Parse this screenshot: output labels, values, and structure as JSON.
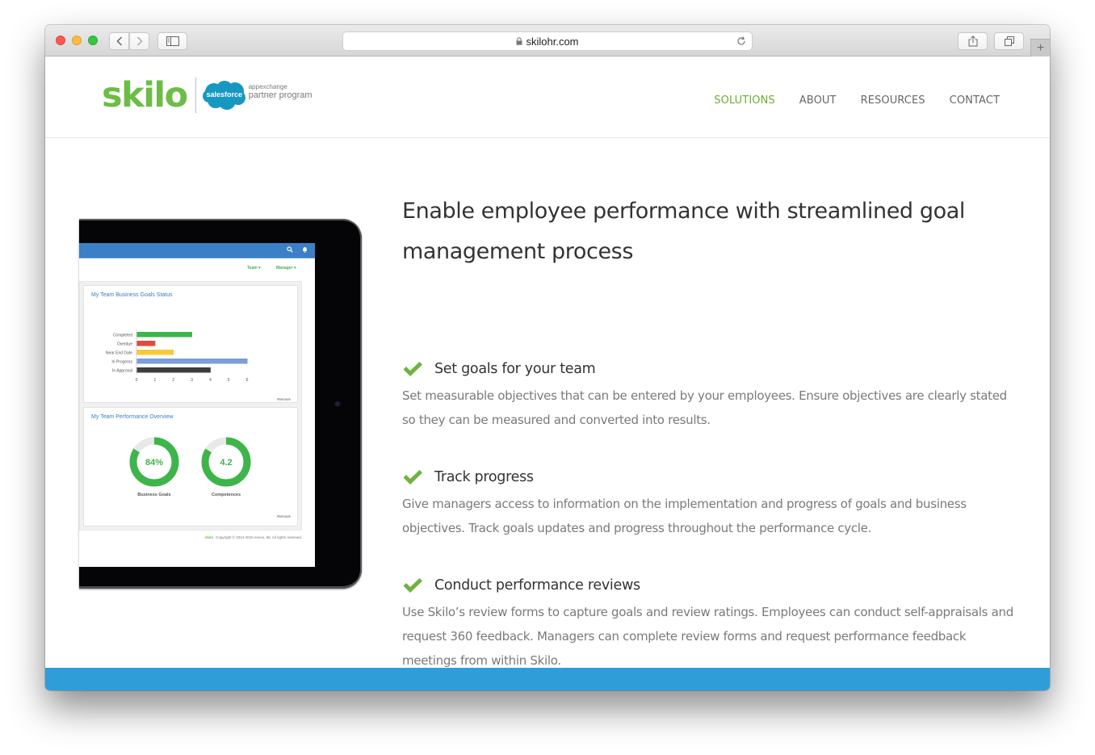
{
  "browser": {
    "url": "skilohr.com",
    "buttons": {
      "back": "back",
      "forward": "forward",
      "sidebar": "sidebar",
      "share": "share",
      "tabs": "tabs",
      "new_tab": "+"
    }
  },
  "site": {
    "logo": {
      "brand": "skilo",
      "partner_badge": "salesforce",
      "partner_small": "appexchange",
      "partner_big": "partner program"
    },
    "nav": [
      {
        "label": "SOLUTIONS",
        "active": true
      },
      {
        "label": "ABOUT",
        "active": false
      },
      {
        "label": "RESOURCES",
        "active": false
      },
      {
        "label": "CONTACT",
        "active": false
      }
    ],
    "colors": {
      "brand_green": "#6cbd45",
      "nav_active": "#6cae34",
      "footer_blue": "#2f9ed8",
      "app_blue": "#3b80c6"
    }
  },
  "tablet_app": {
    "filters": {
      "team": "Team ▾",
      "manager": "Manager ▾"
    },
    "goals_panel": {
      "title": "My Team Business Goals Status",
      "remove": "Remove"
    },
    "performance_panel": {
      "title": "My Team Performance Overview",
      "remove": "Remove",
      "donuts": [
        {
          "label": "Business Goals",
          "value_text": "84%",
          "fraction": 0.84
        },
        {
          "label": "Competences",
          "value_text": "4.2",
          "fraction": 0.84
        }
      ]
    },
    "copyright_logo": "skilo",
    "copyright": "Copyright © 2014-2015 envoo, ltd. All rights reserved."
  },
  "chart_data": {
    "type": "bar",
    "orientation": "horizontal",
    "title": "My Team Business Goals Status",
    "categories": [
      "Completed",
      "Overdue",
      "Near End Date",
      "In Progress",
      "In Approval"
    ],
    "values": [
      3,
      1,
      2,
      6,
      4
    ],
    "colors": [
      "#3db54a",
      "#e04b3a",
      "#f9c93a",
      "#7b9fd6",
      "#3e3e3e"
    ],
    "xlim": [
      0,
      6
    ],
    "xticks": [
      "0",
      "1",
      "2",
      "3",
      "4",
      "5",
      "6"
    ],
    "xlabel": "",
    "ylabel": ""
  },
  "content": {
    "headline": "Enable employee performance with streamlined goal management process",
    "features": [
      {
        "title": "Set goals for your team",
        "description": "Set measurable objectives that can be entered by your employees. Ensure objectives are clearly stated so they can be measured and converted into results."
      },
      {
        "title": "Track progress",
        "description": "Give managers access to information on the implementation and progress of goals and business objectives. Track goals updates and progress throughout the performance cycle."
      },
      {
        "title": "Conduct performance reviews",
        "description": "Use Skilo’s review forms to capture goals and review ratings. Employees can conduct self-appraisals and request 360 feedback. Managers can complete review forms and request performance feedback meetings from within Skilo."
      }
    ]
  }
}
